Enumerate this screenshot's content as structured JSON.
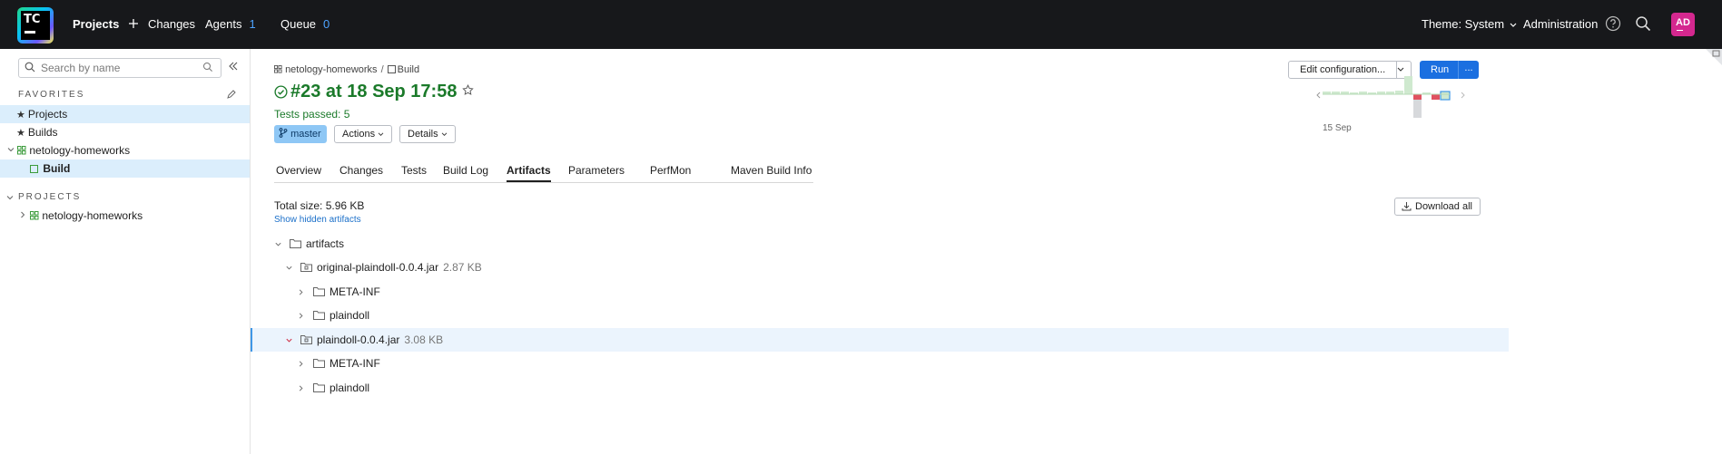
{
  "topbar": {
    "logo_text": "TC",
    "nav": [
      {
        "label": "Projects",
        "count": ""
      },
      {
        "label": "Changes",
        "count": ""
      },
      {
        "label": "Agents",
        "count": "1"
      },
      {
        "label": "Queue",
        "count": "0"
      }
    ],
    "theme_label": "Theme: System",
    "admin_label": "Administration",
    "avatar_initials": "AD"
  },
  "sidebar": {
    "search_placeholder": "Search by name",
    "favorites_title": "FAVORITES",
    "favorites": [
      "Projects",
      "Builds"
    ],
    "project_root": "netology-homeworks",
    "build_item": "Build",
    "projects_title": "PROJECTS",
    "projects": [
      "netology-homeworks"
    ]
  },
  "build": {
    "breadcrumb": [
      "netology-homeworks",
      "Build"
    ],
    "title": "#23 at 18 Sep 17:58",
    "tests_passed": "Tests passed: 5",
    "branch": "master",
    "actions_label": "Actions",
    "details_label": "Details",
    "edit_configuration_label": "Edit configuration...",
    "run_label": "Run",
    "run_more_label": "...",
    "history_date": "15 Sep"
  },
  "tabs": [
    "Overview",
    "Changes",
    "Tests",
    "Build Log",
    "Artifacts",
    "Parameters",
    "PerfMon",
    "Maven Build Info"
  ],
  "artifacts": {
    "total_size": "Total size: 5.96 KB",
    "show_hidden": "Show hidden artifacts",
    "download_all": "Download all",
    "tree": [
      {
        "name": "artifacts",
        "size": "",
        "level": 0,
        "expanded": true
      },
      {
        "name": "original-plaindoll-0.0.4.jar",
        "size": "2.87 KB",
        "level": 1,
        "expanded": true
      },
      {
        "name": "META-INF",
        "size": "",
        "level": 2,
        "expanded": false
      },
      {
        "name": "plaindoll",
        "size": "",
        "level": 2,
        "expanded": false
      },
      {
        "name": "plaindoll-0.0.4.jar",
        "size": "3.08 KB",
        "level": 1,
        "expanded": true
      },
      {
        "name": "META-INF",
        "size": "",
        "level": 2,
        "expanded": false
      },
      {
        "name": "plaindoll",
        "size": "",
        "level": 2,
        "expanded": false
      }
    ]
  },
  "colors": {
    "topbar_bg": "#17181b",
    "success_green": "#1b7a2a",
    "accent_blue": "#1b6fe0",
    "selection_bg": "#dbeefc"
  }
}
